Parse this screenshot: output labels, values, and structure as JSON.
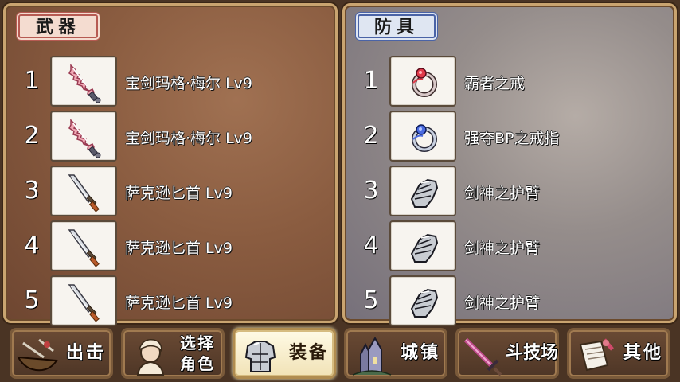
{
  "weapons": {
    "title": "武器",
    "items": [
      {
        "num": "1",
        "name": "宝剑玛格·梅尔 Lv9",
        "icon": "pink-sword-icon"
      },
      {
        "num": "2",
        "name": "宝剑玛格·梅尔 Lv9",
        "icon": "pink-sword-icon"
      },
      {
        "num": "3",
        "name": "萨克逊匕首 Lv9",
        "icon": "dagger-icon"
      },
      {
        "num": "4",
        "name": "萨克逊匕首 Lv9",
        "icon": "dagger-icon"
      },
      {
        "num": "5",
        "name": "萨克逊匕首 Lv9",
        "icon": "dagger-icon"
      }
    ]
  },
  "armor": {
    "title": "防具",
    "items": [
      {
        "num": "1",
        "name": "霸者之戒",
        "icon": "red-ring-icon"
      },
      {
        "num": "2",
        "name": "强夺BP之戒指",
        "icon": "blue-ring-icon"
      },
      {
        "num": "3",
        "name": "剑神之护臂",
        "icon": "gauntlet-icon"
      },
      {
        "num": "4",
        "name": "剑神之护臂",
        "icon": "gauntlet-icon"
      },
      {
        "num": "5",
        "name": "剑神之护臂",
        "icon": "gauntlet-icon"
      }
    ]
  },
  "nav": {
    "sortie": "出击",
    "select_line1": "选择",
    "select_line2": "角色",
    "equip": "装备",
    "town": "城镇",
    "arena": "斗技场",
    "other": "其他",
    "active": "equip"
  },
  "colors": {
    "weapon_accent": "#b65a52",
    "armor_accent": "#4a63a6",
    "panel_border": "#c9a470"
  }
}
